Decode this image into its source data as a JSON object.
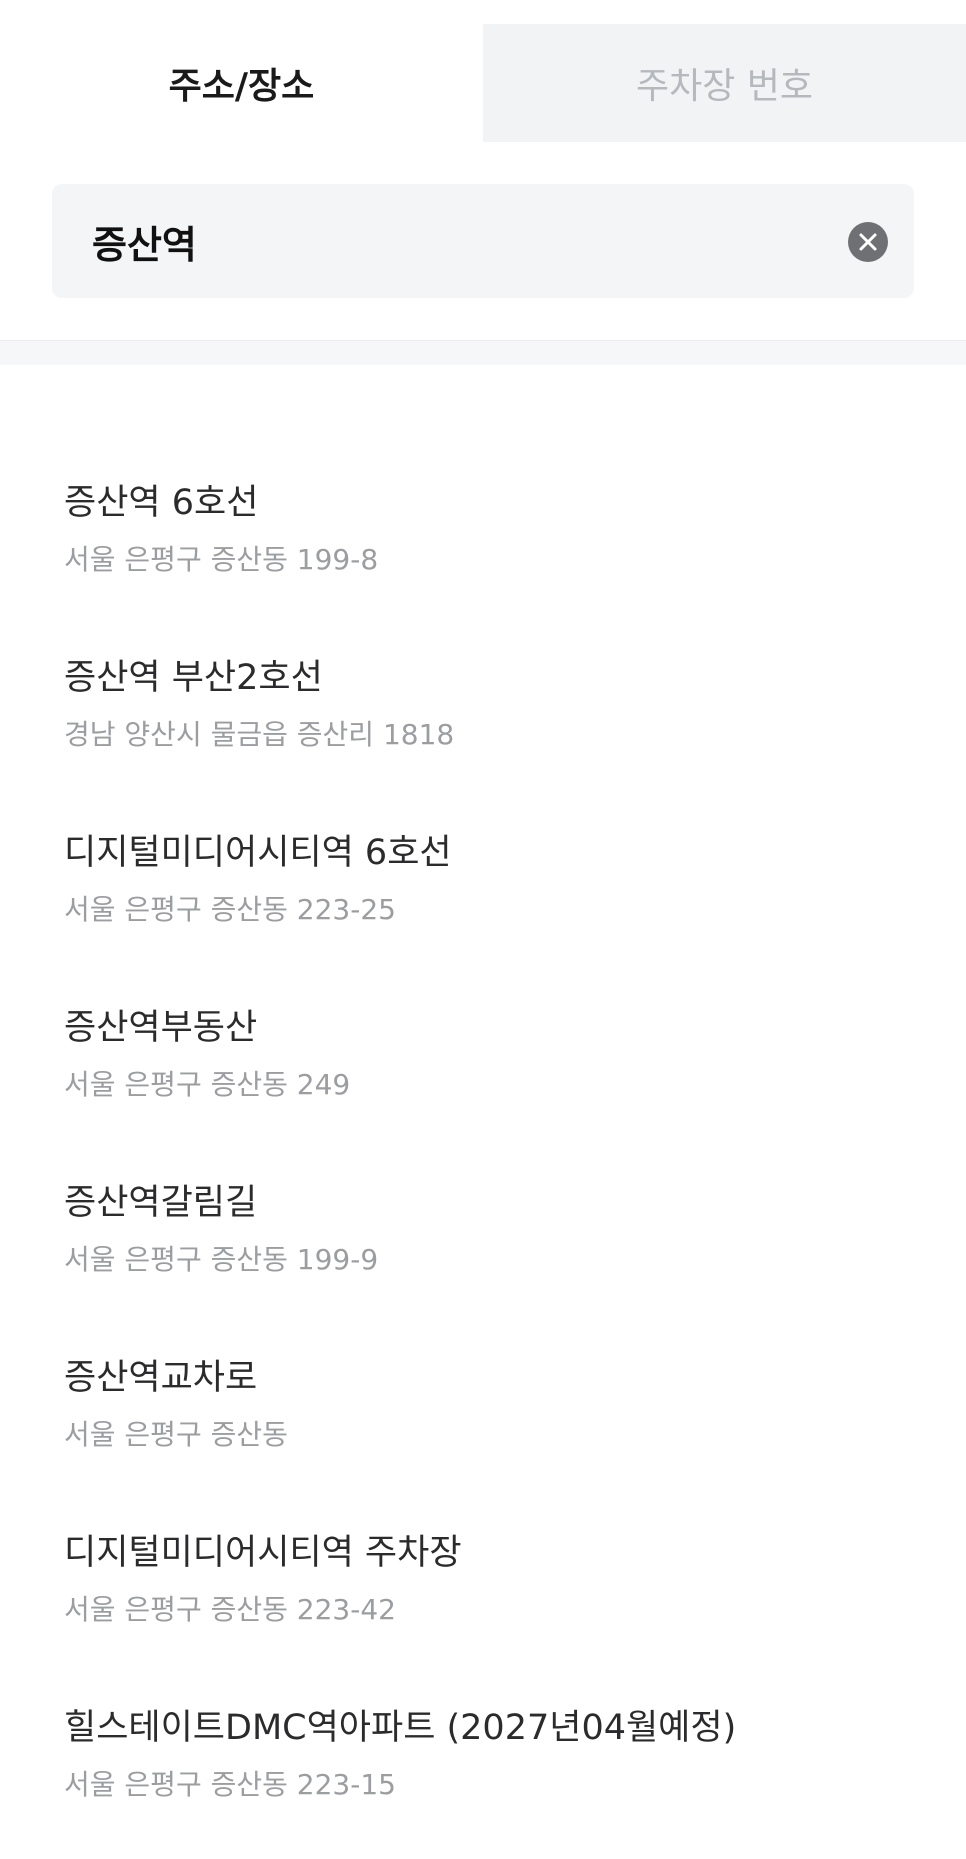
{
  "tabs": [
    {
      "label": "주소/장소",
      "active": true
    },
    {
      "label": "주차장 번호",
      "active": false
    }
  ],
  "search": {
    "value": "증산역",
    "clear_icon": "close-circle-icon"
  },
  "results": [
    {
      "name": "증산역 6호선",
      "address": "서울 은평구 증산동 199-8"
    },
    {
      "name": "증산역 부산2호선",
      "address": "경남 양산시 물금읍 증산리 1818"
    },
    {
      "name": "디지털미디어시티역 6호선",
      "address": "서울 은평구 증산동 223-25"
    },
    {
      "name": "증산역부동산",
      "address": "서울 은평구 증산동 249"
    },
    {
      "name": "증산역갈림길",
      "address": "서울 은평구 증산동 199-9"
    },
    {
      "name": "증산역교차로",
      "address": "서울 은평구 증산동"
    },
    {
      "name": "디지털미디어시티역 주차장",
      "address": "서울 은평구 증산동 223-42"
    },
    {
      "name": "힐스테이트DMC역아파트 (2027년04월예정)",
      "address": "서울 은평구 증산동 223-15"
    }
  ],
  "colors": {
    "active_tab_text": "#1a1a1a",
    "inactive_tab_text": "#b5b8bd",
    "inactive_tab_bg": "#f2f3f5",
    "search_bg": "#f4f5f7",
    "result_name": "#2b2b2d",
    "result_address": "#9b9da1"
  }
}
